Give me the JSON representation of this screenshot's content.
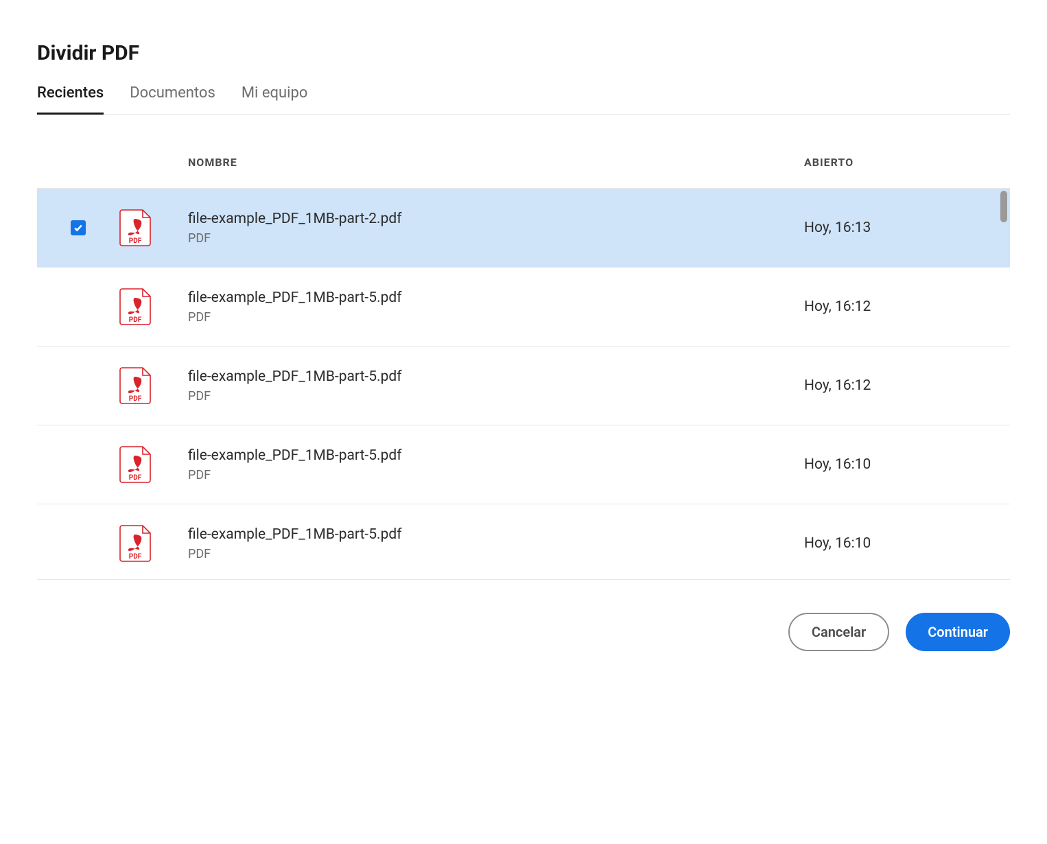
{
  "title": "Dividir PDF",
  "tabs": [
    {
      "label": "Recientes",
      "active": true
    },
    {
      "label": "Documentos",
      "active": false
    },
    {
      "label": "Mi equipo",
      "active": false
    }
  ],
  "columns": {
    "name": "NOMBRE",
    "opened": "ABIERTO"
  },
  "pdf_icon_label": "PDF",
  "files": [
    {
      "name": "file-example_PDF_1MB-part-2.pdf",
      "type": "PDF",
      "opened": "Hoy, 16:13",
      "selected": true
    },
    {
      "name": "file-example_PDF_1MB-part-5.pdf",
      "type": "PDF",
      "opened": "Hoy, 16:12",
      "selected": false
    },
    {
      "name": "file-example_PDF_1MB-part-5.pdf",
      "type": "PDF",
      "opened": "Hoy, 16:12",
      "selected": false
    },
    {
      "name": "file-example_PDF_1MB-part-5.pdf",
      "type": "PDF",
      "opened": "Hoy, 16:10",
      "selected": false
    },
    {
      "name": "file-example_PDF_1MB-part-5.pdf",
      "type": "PDF",
      "opened": "Hoy, 16:10",
      "selected": false
    }
  ],
  "footer": {
    "cancel": "Cancelar",
    "continue": "Continuar"
  }
}
